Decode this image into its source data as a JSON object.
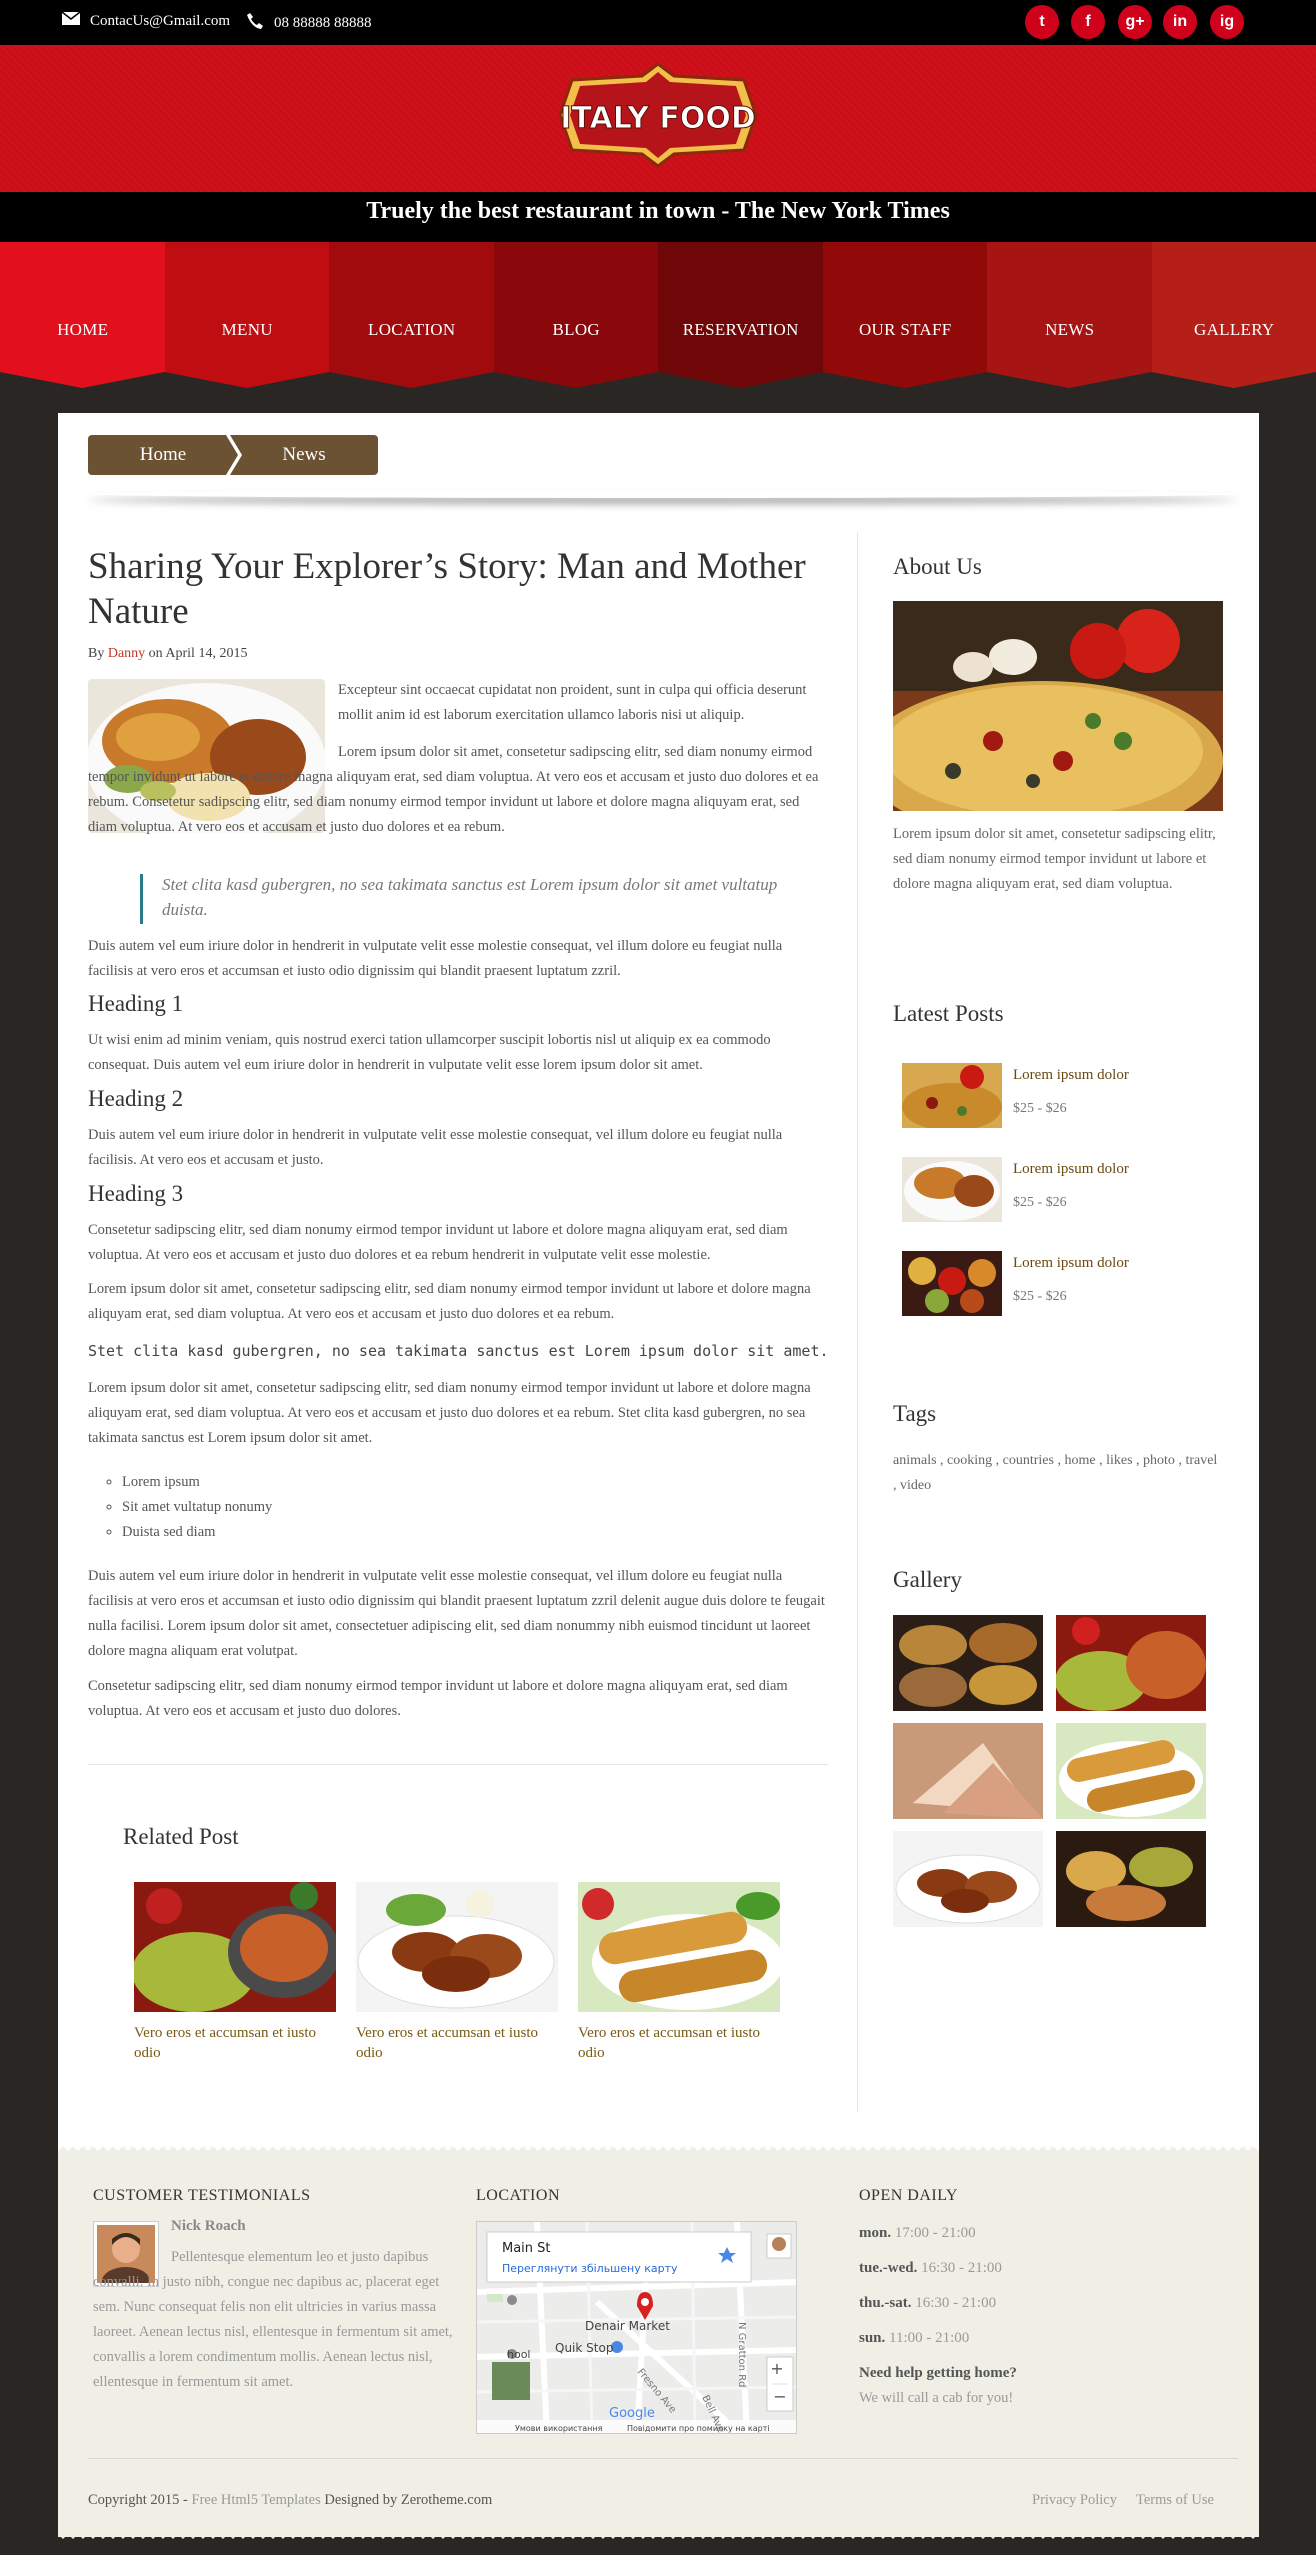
{
  "topbar": {
    "email": "ContacUs@Gmail.com",
    "phone": "08 88888 88888",
    "social": [
      "t",
      "f",
      "g+",
      "in",
      "ig"
    ]
  },
  "header": {
    "logo_text": "ITALY FOOD",
    "tagline": "Truely the best restaurant in town - The New York Times"
  },
  "nav": [
    {
      "label": "HOME",
      "color": "#e2101c"
    },
    {
      "label": "MENU",
      "color": "#bf0d12"
    },
    {
      "label": "LOCATION",
      "color": "#a20b0e"
    },
    {
      "label": "BLOG",
      "color": "#8a080b"
    },
    {
      "label": "RESERVATION",
      "color": "#6f0607"
    },
    {
      "label": "OUR STAFF",
      "color": "#920909"
    },
    {
      "label": "NEWS",
      "color": "#a61513"
    },
    {
      "label": "GALLERY",
      "color": "#b51f17"
    }
  ],
  "breadcrumb": {
    "home": "Home",
    "current": "News"
  },
  "post": {
    "title": "Sharing Your Explorer’s Story: Man and Mother Nature",
    "by": "By",
    "author": "Danny",
    "on": "on April 14, 2015",
    "p1": "Excepteur sint occaecat cupidatat non proident, sunt in culpa qui officia deserunt mollit anim id est laborum exercitation ullamco laboris nisi ut aliquip.",
    "p2": "Lorem ipsum dolor sit amet, consetetur sadipscing elitr, sed diam nonumy eirmod tempor invidunt ut labore et dolore magna aliquyam erat, sed diam voluptua. At vero eos et accusam et justo duo dolores et ea rebum. Consetetur sadipscing elitr, sed diam nonumy eirmod tempor invidunt ut labore et dolore magna aliquyam erat, sed diam voluptua. At vero eos et accusam et justo duo dolores et ea rebum.",
    "quote": "Stet clita kasd gubergren, no sea takimata sanctus est Lorem ipsum dolor sit amet vultatup duista.",
    "p3": "Duis autem vel eum iriure dolor in hendrerit in vulputate velit esse molestie consequat, vel illum dolore eu feugiat nulla facilisis at vero eros et accumsan et iusto odio dignissim qui blandit praesent luptatum zzril.",
    "h1": "Heading 1",
    "p4": "Ut wisi enim ad minim veniam, quis nostrud exerci tation ullamcorper suscipit lobortis nisl ut aliquip ex ea commodo consequat. Duis autem vel eum iriure dolor in hendrerit in vulputate velit esse lorem ipsum dolor sit amet.",
    "h2": "Heading 2",
    "p5": "Duis autem vel eum iriure dolor in hendrerit in vulputate velit esse molestie consequat, vel illum dolore eu feugiat nulla facilisis. At vero eos et accusam et justo.",
    "h3": "Heading 3",
    "p6": "Consetetur sadipscing elitr, sed diam nonumy eirmod tempor invidunt ut labore et dolore magna aliquyam erat, sed diam voluptua. At vero eos et accusam et justo duo dolores et ea rebum hendrerit in vulputate velit esse molestie.",
    "p7": "Lorem ipsum dolor sit amet, consetetur sadipscing elitr, sed diam nonumy eirmod tempor invidunt ut labore et dolore magna aliquyam erat, sed diam voluptua. At vero eos et accusam et justo duo dolores et ea rebum.",
    "code": "Stet clita kasd gubergren, no sea takimata sanctus est Lorem ipsum dolor sit amet.",
    "p8": "Lorem ipsum dolor sit amet, consetetur sadipscing elitr, sed diam nonumy eirmod tempor invidunt ut labore et dolore magna aliquyam erat, sed diam voluptua. At vero eos et accusam et justo duo dolores et ea rebum. Stet clita kasd gubergren, no sea takimata sanctus est Lorem ipsum dolor sit amet.",
    "list": [
      "Lorem ipsum",
      "Sit amet vultatup nonumy",
      "Duista sed diam"
    ],
    "p9": "Duis autem vel eum iriure dolor in hendrerit in vulputate velit esse molestie consequat, vel illum dolore eu feugiat nulla facilisis at vero eros et accumsan et iusto odio dignissim qui blandit praesent luptatum zzril delenit augue duis dolore te feugait nulla facilisi. Lorem ipsum dolor sit amet, consectetuer adipiscing elit, sed diam nonummy nibh euismod tincidunt ut laoreet dolore magna aliquam erat volutpat.",
    "p10": "Consetetur sadipscing elitr, sed diam nonumy eirmod tempor invidunt ut labore et dolore magna aliquyam erat, sed diam voluptua. At vero eos et accusam et justo duo dolores."
  },
  "related": {
    "title": "Related Post",
    "items": [
      "Vero eros et accumsan et iusto odio",
      "Vero eros et accumsan et iusto odio",
      "Vero eros et accumsan et iusto odio"
    ]
  },
  "sidebar": {
    "about_title": "About Us",
    "about_text": "Lorem ipsum dolor sit amet, consetetur sadipscing elitr, sed diam nonumy eirmod tempor invidunt ut labore et dolore magna aliquyam erat, sed diam voluptua.",
    "latest_title": "Latest Posts",
    "latest": [
      {
        "title": "Lorem ipsum dolor",
        "price": "$25 - $26"
      },
      {
        "title": "Lorem ipsum dolor",
        "price": "$25 - $26"
      },
      {
        "title": "Lorem ipsum dolor",
        "price": "$25 - $26"
      }
    ],
    "tags_title": "Tags",
    "tags": [
      "animals",
      "cooking",
      "countries",
      "home",
      "likes",
      "photo",
      "travel",
      "video"
    ],
    "gallery_title": "Gallery"
  },
  "footer": {
    "testimonials_title": "CUSTOMER TESTIMONIALS",
    "testimonial_name": "Nick Roach",
    "testimonial_text": "Pellentesque elementum leo et justo dapibus convalli. In justo nibh, congue nec dapibus ac, placerat eget sem. Nunc consequat felis non elit ultricies in varius massa laoreet. Aenean lectus nisl, ellentesque in fermentum sit amet, convallis a lorem condimentum mollis. Aenean lectus nisl, ellentesque in fermentum sit amet.",
    "location_title": "LOCATION",
    "map": {
      "place": "Main St",
      "link": "Переглянути збільшену карту",
      "label1": "Denair Market",
      "label2": "Quik Stop",
      "label3": "hool",
      "road1": "N Gratton Rd",
      "road2": "Fresno Ave",
      "road3": "Bell Ave",
      "footer1": "Умови використання",
      "footer2": "Повідомити про помилку на карті",
      "google": "Google",
      "plus": "+",
      "minus": "−"
    },
    "open_title": "OPEN DAILY",
    "hours": [
      {
        "day": "mon.",
        "time": "17:00 - 21:00"
      },
      {
        "day": "tue.-wed.",
        "time": "16:30 - 21:00"
      },
      {
        "day": "thu.-sat.",
        "time": "16:30 - 21:00"
      },
      {
        "day": "sun.",
        "time": "11:00 - 21:00"
      }
    ],
    "help_title": "Need help getting home?",
    "help_text": "We will call a cab for you!",
    "copyright_a": "Copyright 2015 - ",
    "copyright_b": "Free Html5 Templates",
    "copyright_c": " Designed by ",
    "copyright_d": "Zerotheme.com",
    "privacy": "Privacy Policy",
    "terms": "Terms of Use"
  }
}
